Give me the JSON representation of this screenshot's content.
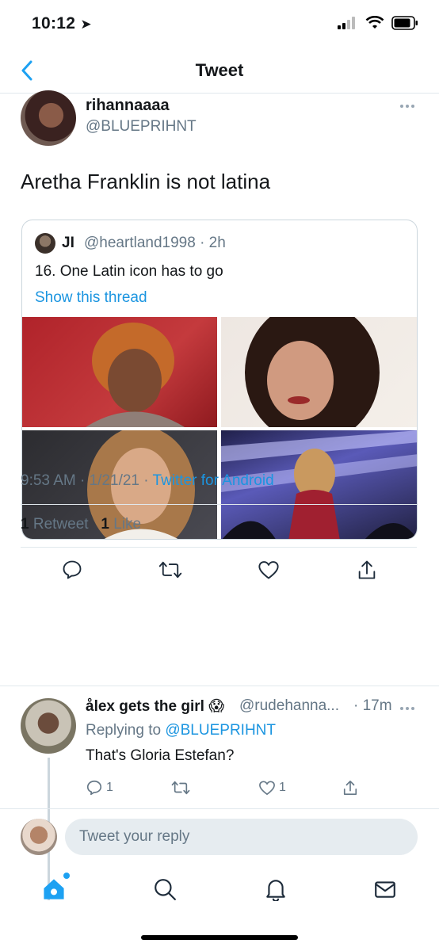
{
  "status": {
    "time": "10:12"
  },
  "nav": {
    "title": "Tweet"
  },
  "tweet": {
    "display_name": "rihannaaaa",
    "handle": "@BLUEPRIHNT",
    "text": "Aretha Franklin is not latina",
    "quote": {
      "name": "JI",
      "handle_time": "@heartland1998 · 2h",
      "text": "16. One Latin icon has to go",
      "thread_link": "Show this thread"
    },
    "meta_time": "9:53 AM · 1/21/21 · ",
    "meta_source": "Twitter for Android",
    "retweets": "1",
    "retweets_label": " Retweet",
    "likes": "1",
    "likes_label": " Like"
  },
  "reply": {
    "display_name": "ålex gets the girl 😱",
    "handle": "@rudehanna...",
    "time": "· 17m",
    "replying_to_prefix": "Replying to ",
    "replying_to": "@BLUEPRIHNT",
    "text": "That's Gloria Estefan?",
    "reply_count": "1",
    "like_count": "1"
  },
  "composer": {
    "placeholder": "Tweet your reply"
  },
  "colors": {
    "accent": "#1da1f2",
    "link": "#1b95e0",
    "muted": "#657786"
  }
}
